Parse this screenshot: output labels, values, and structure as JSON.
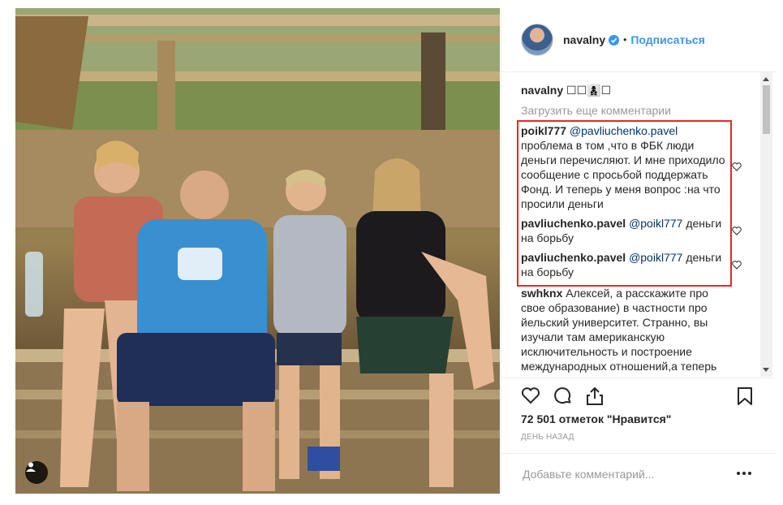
{
  "post": {
    "username": "navalny",
    "follow_label": "Подписаться",
    "dot": "•",
    "verified_icon": "verified-badge-icon",
    "caption_user": "navalny",
    "caption_text": "☐☐👩‍👦‍👦☐",
    "load_more_label": "Загрузить еще комментарии",
    "likes_text": "72 501 отметок \"Нравится\"",
    "timestamp": "ДЕНЬ НАЗАД",
    "comment_placeholder": "Добавьте комментарий...",
    "accent_color": "#3897f0",
    "highlight_color": "#e8262a"
  },
  "comments": [
    {
      "user": "poikl777",
      "mention": "@pavliuchenko.pavel",
      "text": "проблема в том ,что в ФБК люди деньги перечисляют. И мне приходило сообщение с просьбой поддержать Фонд. И теперь у меня вопрос :на что просили деньги"
    },
    {
      "user": "pavliuchenko.pavel",
      "mention": "@poikl777",
      "text": "деньги на борьбу"
    },
    {
      "user": "pavliuchenko.pavel",
      "mention": "@poikl777",
      "text": "деньги на борьбу"
    },
    {
      "user": "swhknx",
      "mention": "",
      "text": "Алексей, а расскажите про свое образование) в частности про йельский университет. Странно, вы изучали там американскую исключительность и построение международных отношений,а теперь"
    }
  ],
  "icons": {
    "like": "heart-icon",
    "comment": "comment-icon",
    "share": "share-icon",
    "save": "bookmark-icon",
    "tag": "user-tag-icon",
    "more": "more-options-icon"
  }
}
